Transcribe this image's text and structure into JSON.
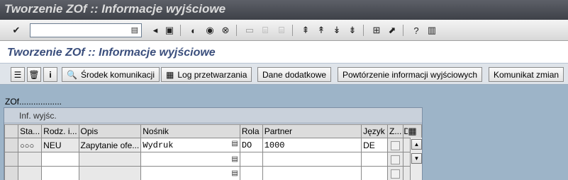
{
  "window": {
    "title": "Tworzenie ZOf :: Informacje wyjściowe"
  },
  "toolbar": {
    "command_field_value": "",
    "icons": [
      "enter-icon",
      "save-icon",
      "back-icon",
      "exit-icon",
      "cancel-icon",
      "print-icon",
      "find-icon",
      "find-next-icon",
      "first-page-icon",
      "previous-page-icon",
      "next-page-icon",
      "last-page-icon",
      "create-session-icon",
      "shortcut-icon",
      "help-icon",
      "layout-menu-icon"
    ]
  },
  "screen": {
    "header": "Tworzenie ZOf :: Informacje wyjściowe"
  },
  "app_toolbar": {
    "buttons": [
      {
        "label": "Środek komunikacji",
        "icon": "search-icon"
      },
      {
        "label": "Log przetwarzania",
        "icon": "table-icon"
      },
      {
        "label": "Dane dodatkowe"
      },
      {
        "label": "Powtórzenie informacji wyjściowych"
      },
      {
        "label": "Komunikat zmian"
      }
    ]
  },
  "doc_label": "ZOf..................",
  "panel": {
    "title": "Inf. wyjśc.",
    "columns": [
      "Sta...",
      "Rodz. i...",
      "Opis",
      "Nośnik",
      "Rola",
      "Partner",
      "Język",
      "Z...",
      "D..."
    ],
    "rows": [
      {
        "status": "○○○",
        "type": "NEU",
        "desc": "Zapytanie ofe...",
        "medium": "Wydruk",
        "role": "DO",
        "partner": "1000",
        "lang": "DE"
      },
      {
        "status": "",
        "type": "",
        "desc": "",
        "medium": "",
        "role": "",
        "partner": "",
        "lang": ""
      },
      {
        "status": "",
        "type": "",
        "desc": "",
        "medium": "",
        "role": "",
        "partner": "",
        "lang": ""
      }
    ]
  },
  "colors": {
    "title_bg": "#4a4d54",
    "header_text": "#3a4e7c",
    "workspace_bg": "#9db4c8"
  }
}
